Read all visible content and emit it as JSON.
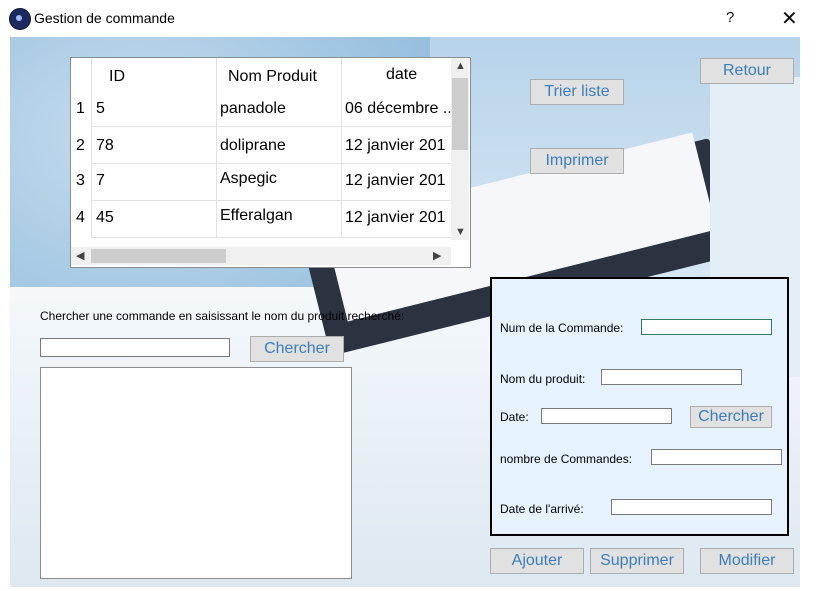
{
  "window": {
    "title": "Gestion de commande",
    "help": "?",
    "close": "✕"
  },
  "table": {
    "headers": [
      "ID",
      "Nom Produit",
      "date"
    ],
    "rows": [
      {
        "n": "1",
        "id": "5",
        "produit": "panadole",
        "date": "06 décembre ..."
      },
      {
        "n": "2",
        "id": "78",
        "produit": "doliprane",
        "date": "12 janvier 201"
      },
      {
        "n": "3",
        "id": "7",
        "produit": "Aspegic",
        "date": "12 janvier 201"
      },
      {
        "n": "4",
        "id": "45",
        "produit": "Efferalgan",
        "date": "12 janvier 201"
      }
    ]
  },
  "buttons": {
    "trier": "Trier liste",
    "imprimer": "Imprimer",
    "retour": "Retour",
    "chercher_left": "Chercher",
    "chercher_form": "Chercher",
    "ajouter": "Ajouter",
    "supprimer": "Supprimer",
    "modifier": "Modifier"
  },
  "search": {
    "label": "Chercher une commande en saisissant le nom du produit recherché:",
    "value": ""
  },
  "form": {
    "num_label": "Num de la Commande:",
    "nom_label": "Nom du produit:",
    "date_label": "Date:",
    "nombre_label": "nombre de Commandes:",
    "arrive_label": "Date de l'arrivé:",
    "num_value": "",
    "nom_value": "",
    "date_value": "",
    "nombre_value": "",
    "arrive_value": ""
  },
  "colors": {
    "button_text": "#3a7ebf",
    "form_bg": "#e6f3ff"
  }
}
